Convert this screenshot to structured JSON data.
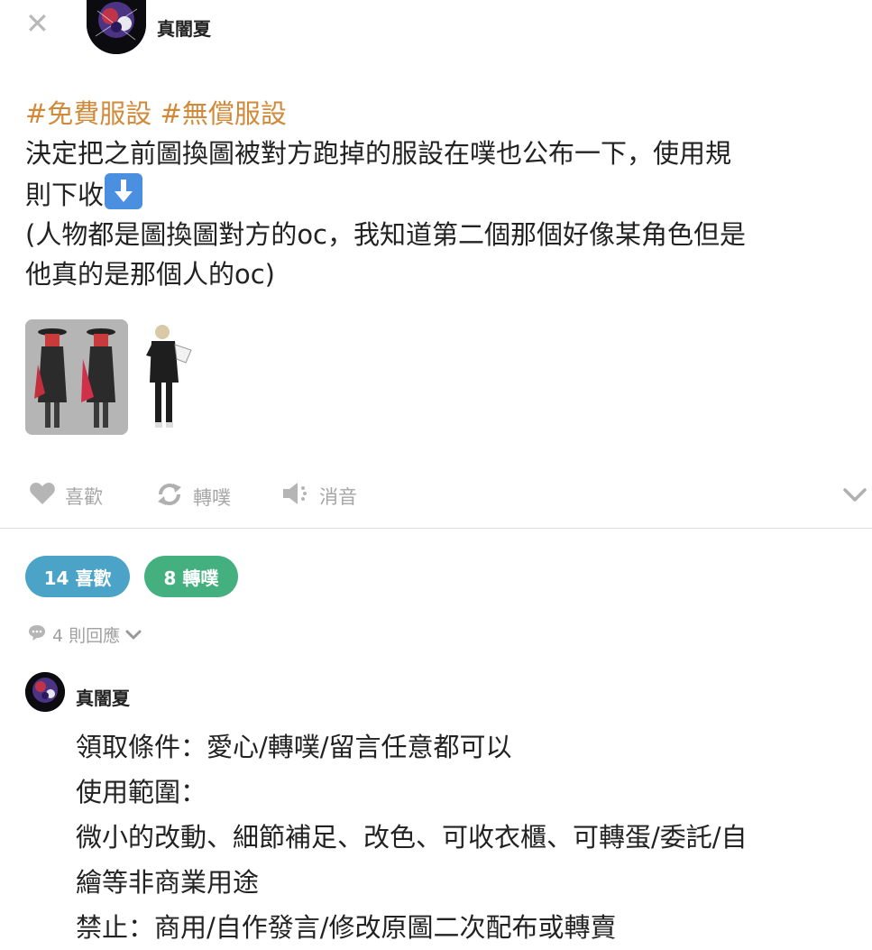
{
  "header": {
    "close_icon": "close-icon",
    "author_name": "真闇夏"
  },
  "post": {
    "hashtags": "#免費服設 #無償服設",
    "body_line1": "決定把之前圖換圖被對方跑掉的服設在噗也公布一下，使用規",
    "body_line2": "則下收",
    "body_emoji": "down-arrow-emoji",
    "body_line3": "(人物都是圖換圖對方的oc，我知道第二個那個好像某角色但是",
    "body_line4": "他真的是那個人的oc)"
  },
  "actions": {
    "like_label": "喜歡",
    "replurk_label": "轉噗",
    "mute_label": "消音"
  },
  "stats": {
    "likes_label": "14 喜歡",
    "replurks_label": "8 轉噗",
    "replies_label": "4 則回應"
  },
  "colors": {
    "hashtag": "#d08a3a",
    "likes_pill": "#4ba3c7",
    "replurks_pill": "#45b07f",
    "muted_text": "#a6a6a6"
  },
  "reply": {
    "author_name": "真闇夏",
    "lines": [
      "領取條件：愛心/轉噗/留言任意都可以",
      "使用範圍：",
      "微小的改動、細節補足、改色、可收衣櫃、可轉蛋/委託/自",
      "繪等非商業用途",
      "禁止：商用/自作發言/修改原圖二次配布或轉賣"
    ]
  }
}
